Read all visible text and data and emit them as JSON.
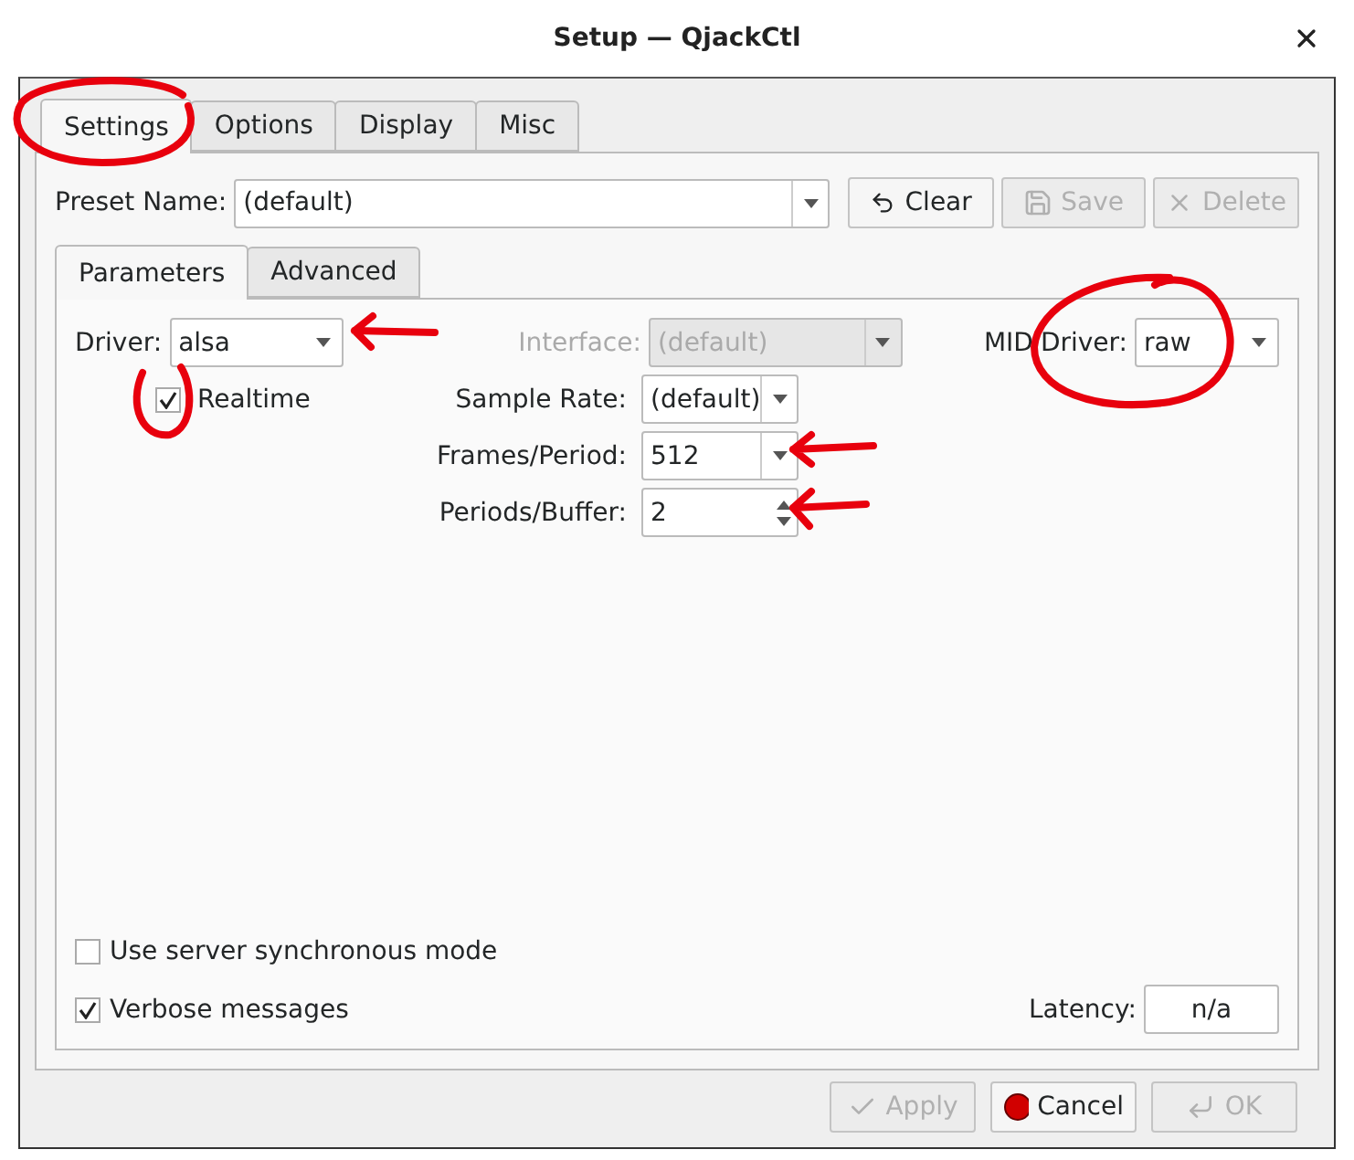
{
  "window": {
    "title": "Setup — QjackCtl"
  },
  "tabs": [
    {
      "label": "Settings",
      "selected": true
    },
    {
      "label": "Options",
      "selected": false
    },
    {
      "label": "Display",
      "selected": false
    },
    {
      "label": "Misc",
      "selected": false
    }
  ],
  "preset": {
    "label": "Preset Name:",
    "value": "(default)"
  },
  "preset_buttons": [
    {
      "label": "Clear",
      "disabled": false,
      "kind": "clear"
    },
    {
      "label": "Save",
      "disabled": true,
      "kind": "save"
    },
    {
      "label": "Delete",
      "disabled": true,
      "kind": "delete"
    }
  ],
  "subtabs": [
    {
      "label": "Parameters",
      "selected": true
    },
    {
      "label": "Advanced",
      "selected": false
    }
  ],
  "driver": {
    "label": "Driver:",
    "value": "alsa"
  },
  "interface": {
    "label": "Interface:",
    "value": "(default)",
    "disabled": true
  },
  "midi_driver": {
    "label_1": "MID",
    "label_2": "Driver:",
    "value": "raw"
  },
  "realtime": {
    "label": "Realtime",
    "checked": true
  },
  "params": [
    {
      "label": "Sample Rate:",
      "value": "(default)",
      "kind": "combo"
    },
    {
      "label": "Frames/Period:",
      "value": "512",
      "kind": "edit-combo"
    },
    {
      "label": "Periods/Buffer:",
      "value": "2",
      "kind": "spin"
    }
  ],
  "options": [
    {
      "label": "Use server synchronous mode",
      "checked": false
    },
    {
      "label": "Verbose messages",
      "checked": true
    }
  ],
  "latency": {
    "label": "Latency:",
    "value": "n/a"
  },
  "buttons": [
    {
      "label": "Apply",
      "disabled": true,
      "kind": "apply"
    },
    {
      "label": "Cancel",
      "disabled": false,
      "kind": "cancel"
    },
    {
      "label": "OK",
      "disabled": true,
      "kind": "ok"
    }
  ]
}
